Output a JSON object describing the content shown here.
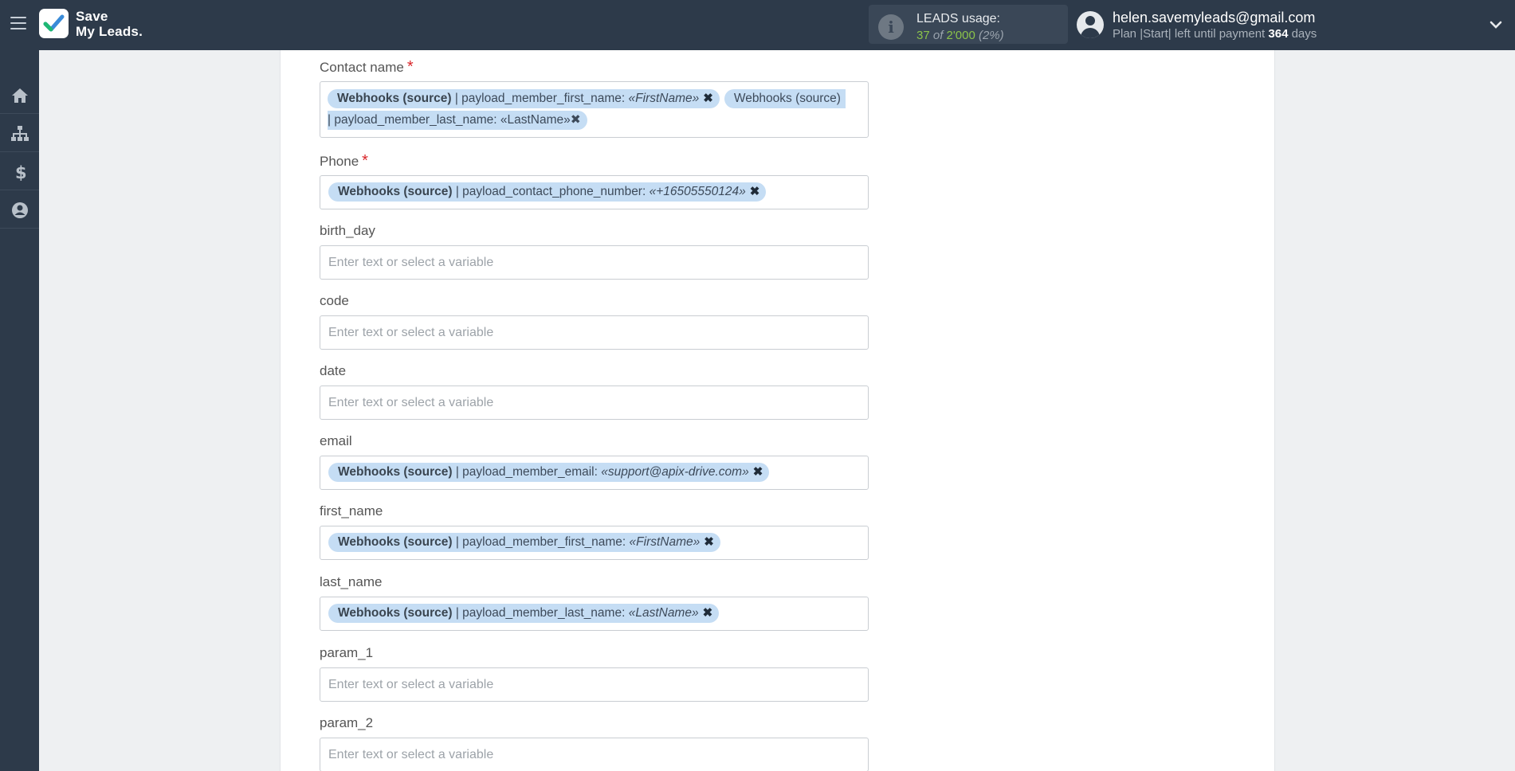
{
  "app": {
    "logo_line1": "Save",
    "logo_line2": "My Leads."
  },
  "usage": {
    "title": "LEADS usage:",
    "used": "37",
    "of_word": " of ",
    "total": "2'000",
    "percent": " (2%)"
  },
  "user": {
    "email": "helen.savemyleads@gmail.com",
    "plan_prefix": "Plan |Start| left until payment ",
    "days": "364",
    "days_suffix": " days"
  },
  "sidebar": {
    "items": [
      {
        "icon": "home-icon"
      },
      {
        "icon": "sitemap-icon"
      },
      {
        "icon": "dollar-icon"
      },
      {
        "icon": "user-circle-icon"
      }
    ]
  },
  "form": {
    "placeholder": "Enter text or select a variable",
    "contact_name": {
      "label": "Contact name",
      "required": "*",
      "chip1": {
        "src": "Webhooks (source)",
        "field": " | payload_member_first_name: ",
        "val": "«FirstName»"
      },
      "chip2": {
        "src": "Webhooks (source)",
        "field": "| payload_member_last_name: ",
        "val": "«LastName»"
      }
    },
    "phone": {
      "label": "Phone",
      "required": "*",
      "chip": {
        "src": "Webhooks (source)",
        "field": " | payload_contact_phone_number: ",
        "val": "«+16505550124»"
      }
    },
    "birth_day": {
      "label": "birth_day"
    },
    "code": {
      "label": "code"
    },
    "date": {
      "label": "date"
    },
    "email": {
      "label": "email",
      "chip": {
        "src": "Webhooks (source)",
        "field": " | payload_member_email: ",
        "val": "«support@apix-drive.com»"
      }
    },
    "first_name": {
      "label": "first_name",
      "chip": {
        "src": "Webhooks (source)",
        "field": " | payload_member_first_name: ",
        "val": "«FirstName»"
      }
    },
    "last_name": {
      "label": "last_name",
      "chip": {
        "src": "Webhooks (source)",
        "field": " | payload_member_last_name: ",
        "val": "«LastName»"
      }
    },
    "param_1": {
      "label": "param_1"
    },
    "param_2": {
      "label": "param_2"
    }
  },
  "colors": {
    "topbar": "#2d3a4a",
    "chip": "#c5ddf4",
    "required": "#d9262a",
    "usage_accent": "#8bc34a"
  }
}
